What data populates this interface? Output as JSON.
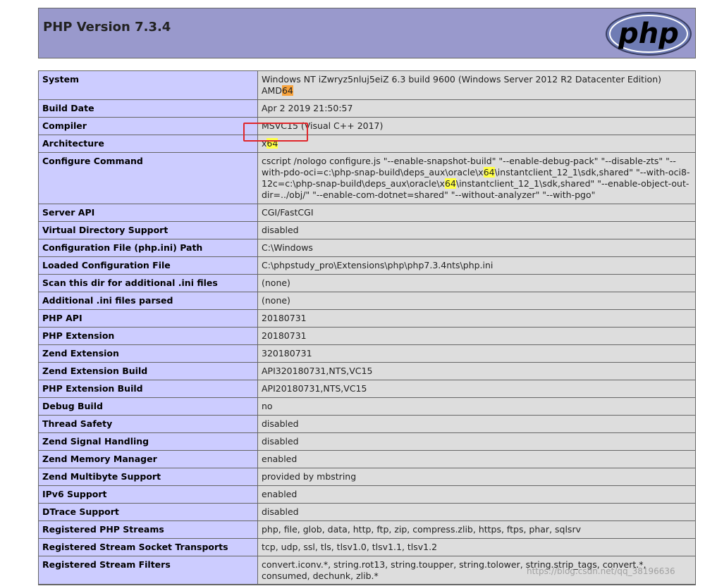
{
  "header": {
    "title": "PHP Version 7.3.4",
    "logo_text": "php"
  },
  "rows": [
    {
      "k": "System",
      "v": [
        {
          "t": "Windows NT iZwryz5nluj5eiZ 6.3 build 9600 (Windows Server 2012 R2 Datacenter Edition) AMD"
        },
        {
          "t": "64",
          "h": "orange"
        }
      ]
    },
    {
      "k": "Build Date",
      "v": [
        {
          "t": "Apr 2 2019 21:50:57"
        }
      ]
    },
    {
      "k": "Compiler",
      "v": [
        {
          "t": "MSVC15 (Visual C++ 2017)"
        }
      ]
    },
    {
      "k": "Architecture",
      "v": [
        {
          "t": "x"
        },
        {
          "t": "64",
          "h": "yellow"
        }
      ]
    },
    {
      "k": "Configure Command",
      "v": [
        {
          "t": "cscript /nologo configure.js \"--enable-snapshot-build\" \"--enable-debug-pack\" \"--disable-zts\" \"--with-pdo-oci=c:\\php-snap-build\\deps_aux\\oracle\\x"
        },
        {
          "t": "64",
          "h": "yellow"
        },
        {
          "t": "\\instantclient_12_1\\sdk,shared\" \"--with-oci8-12c=c:\\php-snap-build\\deps_aux\\oracle\\x"
        },
        {
          "t": "64",
          "h": "yellow"
        },
        {
          "t": "\\instantclient_12_1\\sdk,shared\" \"--enable-object-out-dir=../obj/\" \"--enable-com-dotnet=shared\" \"--without-analyzer\" \"--with-pgo\""
        }
      ]
    },
    {
      "k": "Server API",
      "v": [
        {
          "t": "CGI/FastCGI"
        }
      ]
    },
    {
      "k": "Virtual Directory Support",
      "v": [
        {
          "t": "disabled"
        }
      ]
    },
    {
      "k": "Configuration File (php.ini) Path",
      "v": [
        {
          "t": "C:\\Windows"
        }
      ]
    },
    {
      "k": "Loaded Configuration File",
      "v": [
        {
          "t": "C:\\phpstudy_pro\\Extensions\\php\\php7.3.4nts\\php.ini"
        }
      ]
    },
    {
      "k": "Scan this dir for additional .ini files",
      "v": [
        {
          "t": "(none)"
        }
      ]
    },
    {
      "k": "Additional .ini files parsed",
      "v": [
        {
          "t": "(none)"
        }
      ]
    },
    {
      "k": "PHP API",
      "v": [
        {
          "t": "20180731"
        }
      ]
    },
    {
      "k": "PHP Extension",
      "v": [
        {
          "t": "20180731"
        }
      ]
    },
    {
      "k": "Zend Extension",
      "v": [
        {
          "t": "320180731"
        }
      ]
    },
    {
      "k": "Zend Extension Build",
      "v": [
        {
          "t": "API320180731,NTS,VC15"
        }
      ]
    },
    {
      "k": "PHP Extension Build",
      "v": [
        {
          "t": "API20180731,NTS,VC15"
        }
      ]
    },
    {
      "k": "Debug Build",
      "v": [
        {
          "t": "no"
        }
      ]
    },
    {
      "k": "Thread Safety",
      "v": [
        {
          "t": "disabled"
        }
      ]
    },
    {
      "k": "Zend Signal Handling",
      "v": [
        {
          "t": "disabled"
        }
      ]
    },
    {
      "k": "Zend Memory Manager",
      "v": [
        {
          "t": "enabled"
        }
      ]
    },
    {
      "k": "Zend Multibyte Support",
      "v": [
        {
          "t": "provided by mbstring"
        }
      ]
    },
    {
      "k": "IPv6 Support",
      "v": [
        {
          "t": "enabled"
        }
      ]
    },
    {
      "k": "DTrace Support",
      "v": [
        {
          "t": "disabled"
        }
      ]
    },
    {
      "k": "Registered PHP Streams",
      "v": [
        {
          "t": "php, file, glob, data, http, ftp, zip, compress.zlib, https, ftps, phar, sqlsrv"
        }
      ]
    },
    {
      "k": "Registered Stream Socket Transports",
      "v": [
        {
          "t": "tcp, udp, ssl, tls, tlsv1.0, tlsv1.1, tlsv1.2"
        }
      ]
    },
    {
      "k": "Registered Stream Filters",
      "v": [
        {
          "t": "convert.iconv.*, string.rot13, string.toupper, string.tolower, string.strip_tags, convert.*, consumed, dechunk, zlib.*"
        }
      ]
    }
  ],
  "watermark": "https://blog.csdn.net/qq_38196636",
  "colors": {
    "header_bg": "#9999cc",
    "key_bg": "#ccccff",
    "value_bg": "#dddddd",
    "highlight_yellow": "#ffff44",
    "highlight_orange": "#f7a23b",
    "annotation_box": "#e0262b"
  }
}
